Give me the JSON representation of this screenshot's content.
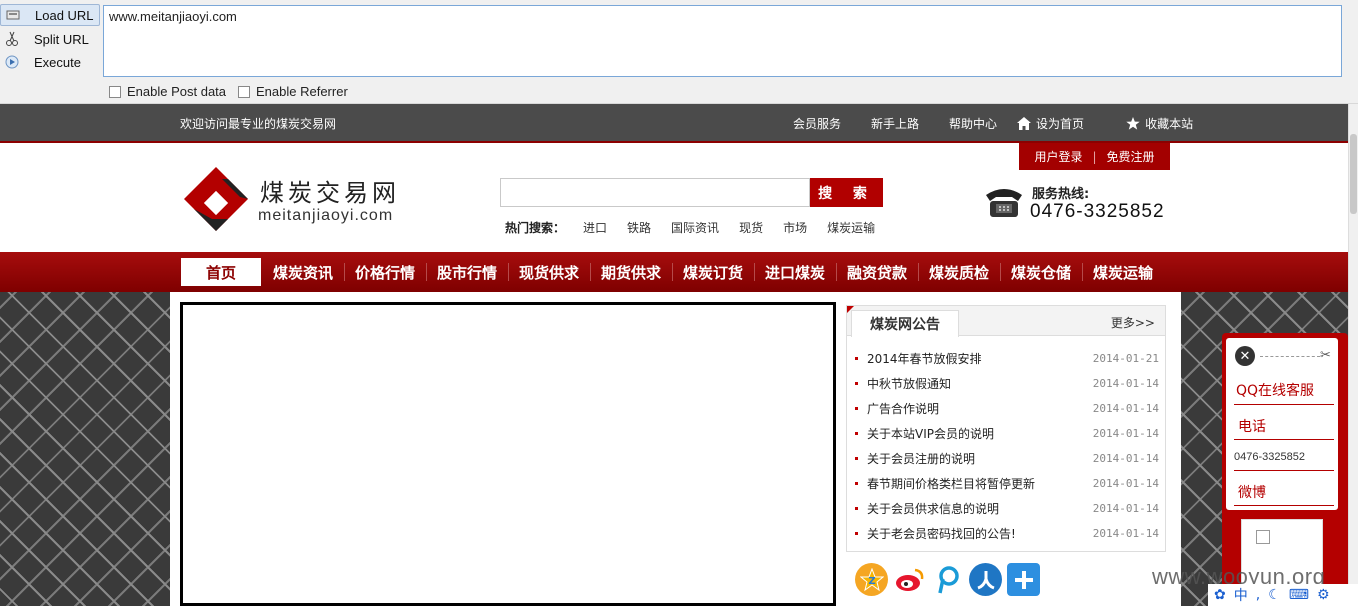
{
  "toolbar": {
    "load_url": "Load URL",
    "split_url": "Split URL",
    "execute": "Execute",
    "url_value": "www.meitanjiaoyi.com",
    "enable_post": "Enable Post data",
    "enable_referrer": "Enable Referrer"
  },
  "topbar": {
    "welcome": "欢迎访问最专业的煤炭交易网",
    "links": [
      "会员服务",
      "新手上路",
      "帮助中心",
      "设为首页",
      "收藏本站"
    ]
  },
  "header": {
    "login": "用户登录",
    "register": "免费注册",
    "separator": "|",
    "logo_cn": "煤炭交易网",
    "logo_en": "meitanjiaoyi.com",
    "search_button": "搜 索",
    "hot_label": "热门搜索：",
    "hot_keywords": [
      "进口",
      "铁路",
      "国际资讯",
      "现货",
      "市场",
      "煤炭运输"
    ],
    "hotline_label": "服务热线:",
    "hotline_number": "0476-3325852"
  },
  "nav": {
    "items": [
      "首页",
      "煤炭资讯",
      "价格行情",
      "股市行情",
      "现货供求",
      "期货供求",
      "煤炭订货",
      "进口煤炭",
      "融资贷款",
      "煤炭质检",
      "煤炭仓储",
      "煤炭运输"
    ]
  },
  "notice": {
    "title": "煤炭网公告",
    "more": "更多>>",
    "items": [
      {
        "title": "2014年春节放假安排",
        "date": "2014-01-21"
      },
      {
        "title": "中秋节放假通知",
        "date": "2014-01-14"
      },
      {
        "title": "广告合作说明",
        "date": "2014-01-14"
      },
      {
        "title": "关于本站VIP会员的说明",
        "date": "2014-01-14"
      },
      {
        "title": "关于会员注册的说明",
        "date": "2014-01-14"
      },
      {
        "title": "春节期间价格类栏目将暂停更新",
        "date": "2014-01-14"
      },
      {
        "title": "关于会员供求信息的说明",
        "date": "2014-01-14"
      },
      {
        "title": "关于老会员密码找回的公告!",
        "date": "2014-01-14"
      }
    ]
  },
  "qq_float": {
    "title": "QQ在线客服",
    "phone_label": "电话",
    "phone": "0476-3325852",
    "weibo": "微博"
  },
  "share_icons": [
    "qzone-icon",
    "weibo-icon",
    "tencent-weibo-icon",
    "renren-icon",
    "more-share-icon"
  ],
  "watermark": "www.wooyun.org",
  "ime": "中",
  "colors": {
    "brand_red": "#8c0000",
    "accent_red": "#b40000",
    "topbar_gray": "#4b4b4b"
  }
}
